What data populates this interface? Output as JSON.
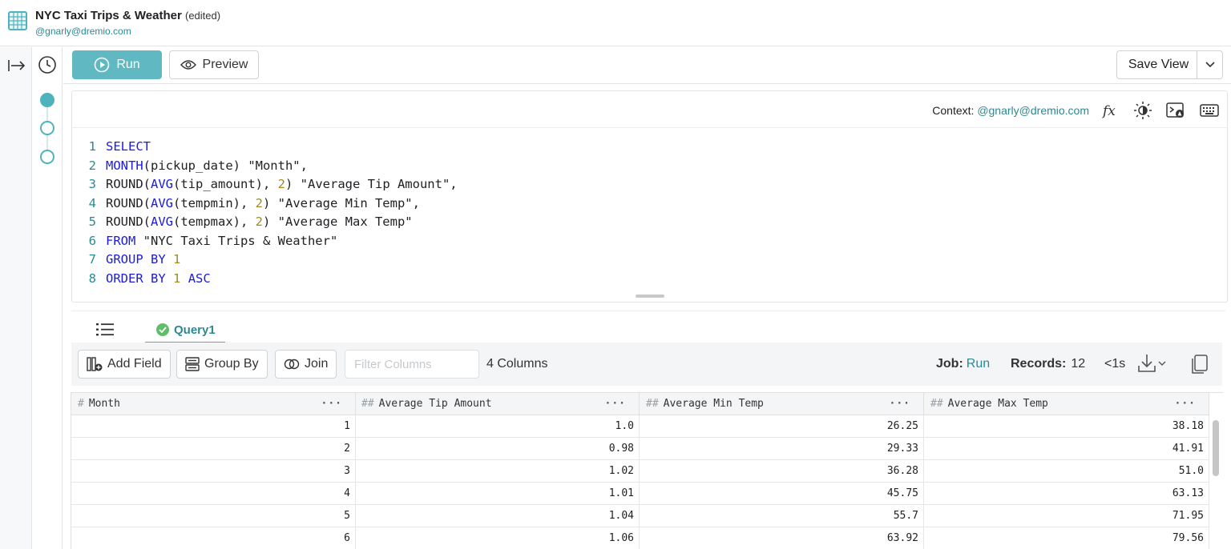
{
  "header": {
    "title": "NYC Taxi Trips & Weather",
    "edited": "(edited)",
    "owner": "@gnarly@dremio.com"
  },
  "toolbar": {
    "run_label": "Run",
    "preview_label": "Preview",
    "save_label": "Save View"
  },
  "editor": {
    "context_label": "Context:",
    "context_value": "@gnarly@dremio.com",
    "lines": [
      {
        "n": "1",
        "parts": [
          {
            "t": "SELECT",
            "c": "kw"
          }
        ]
      },
      {
        "n": "2",
        "parts": [
          {
            "t": "MONTH",
            "c": "kw"
          },
          {
            "t": "(pickup_date) \"Month\",",
            "c": ""
          }
        ]
      },
      {
        "n": "3",
        "parts": [
          {
            "t": "ROUND(",
            "c": ""
          },
          {
            "t": "AVG",
            "c": "kw"
          },
          {
            "t": "(tip_amount), ",
            "c": ""
          },
          {
            "t": "2",
            "c": "num"
          },
          {
            "t": ") \"Average Tip Amount\",",
            "c": ""
          }
        ]
      },
      {
        "n": "4",
        "parts": [
          {
            "t": "ROUND(",
            "c": ""
          },
          {
            "t": "AVG",
            "c": "kw"
          },
          {
            "t": "(tempmin), ",
            "c": ""
          },
          {
            "t": "2",
            "c": "num"
          },
          {
            "t": ") \"Average Min Temp\",",
            "c": ""
          }
        ]
      },
      {
        "n": "5",
        "parts": [
          {
            "t": "ROUND(",
            "c": ""
          },
          {
            "t": "AVG",
            "c": "kw"
          },
          {
            "t": "(tempmax), ",
            "c": ""
          },
          {
            "t": "2",
            "c": "num"
          },
          {
            "t": ") \"Average Max Temp\"",
            "c": ""
          }
        ]
      },
      {
        "n": "6",
        "parts": [
          {
            "t": "FROM",
            "c": "kw"
          },
          {
            "t": " \"NYC Taxi Trips & Weather\"",
            "c": ""
          }
        ]
      },
      {
        "n": "7",
        "parts": [
          {
            "t": "GROUP BY",
            "c": "kw"
          },
          {
            "t": " ",
            "c": ""
          },
          {
            "t": "1",
            "c": "num"
          }
        ]
      },
      {
        "n": "8",
        "parts": [
          {
            "t": "ORDER BY",
            "c": "kw"
          },
          {
            "t": " ",
            "c": ""
          },
          {
            "t": "1",
            "c": "num"
          },
          {
            "t": " ",
            "c": ""
          },
          {
            "t": "ASC",
            "c": "kw"
          }
        ]
      }
    ]
  },
  "tabs": {
    "query_label": "Query1"
  },
  "results_toolbar": {
    "add_field_label": "Add Field",
    "group_by_label": "Group By",
    "join_label": "Join",
    "filter_placeholder": "Filter Columns",
    "column_count": "4 Columns",
    "job_label": "Job:",
    "job_value": "Run",
    "records_label": "Records:",
    "records_value": "12",
    "timing": "<1s"
  },
  "table": {
    "columns": [
      {
        "type_icon": "#",
        "name": "Month"
      },
      {
        "type_icon": "##",
        "name": "Average Tip Amount"
      },
      {
        "type_icon": "##",
        "name": "Average Min Temp"
      },
      {
        "type_icon": "##",
        "name": "Average Max Temp"
      }
    ],
    "more_label": "···",
    "rows": [
      [
        "1",
        "1.0",
        "26.25",
        "38.18"
      ],
      [
        "2",
        "0.98",
        "29.33",
        "41.91"
      ],
      [
        "3",
        "1.02",
        "36.28",
        "51.0"
      ],
      [
        "4",
        "1.01",
        "45.75",
        "63.13"
      ],
      [
        "5",
        "1.04",
        "55.7",
        "71.95"
      ],
      [
        "6",
        "1.06",
        "63.92",
        "79.56"
      ]
    ]
  },
  "colors": {
    "accent": "#4fb3bd",
    "run_button": "#5fb8c2",
    "keyword": "#1a1ae0",
    "number": "#a08a1e",
    "link": "#2a8a94",
    "success": "#5dbf68"
  }
}
